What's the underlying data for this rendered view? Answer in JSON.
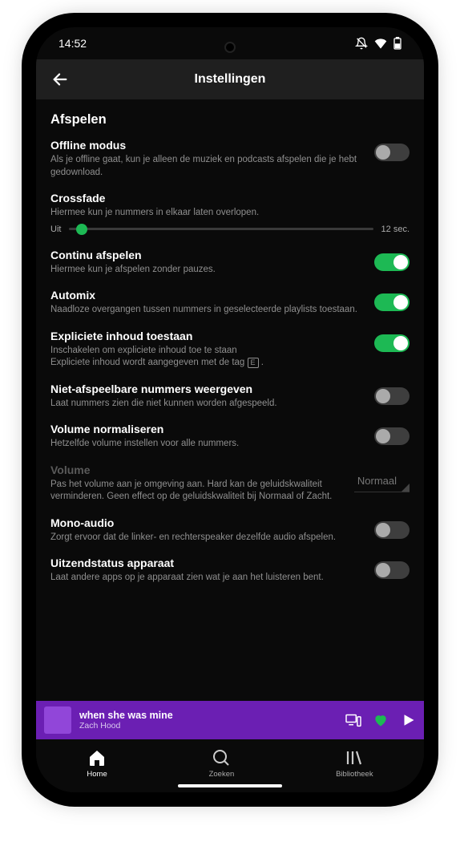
{
  "status": {
    "time": "14:52"
  },
  "header": {
    "title": "Instellingen"
  },
  "section": {
    "title": "Afspelen"
  },
  "settings": {
    "offline": {
      "title": "Offline modus",
      "desc": "Als je offline gaat, kun je alleen de muziek en podcasts afspelen die je hebt gedownload."
    },
    "crossfade": {
      "title": "Crossfade",
      "desc": "Hiermee kun je nummers in elkaar laten overlopen.",
      "min": "Uit",
      "max": "12 sec."
    },
    "continuous": {
      "title": "Continu afspelen",
      "desc": "Hiermee kun je afspelen zonder pauzes."
    },
    "automix": {
      "title": "Automix",
      "desc": "Naadloze overgangen tussen nummers in geselecteerde playlists toestaan."
    },
    "explicit": {
      "title": "Expliciete inhoud toestaan",
      "desc1": "Inschakelen om expliciete inhoud toe te staan",
      "desc2a": "Expliciete inhoud wordt aangegeven met de tag ",
      "tag": "E",
      "desc2b": " ."
    },
    "unplayable": {
      "title": "Niet-afspeelbare nummers weergeven",
      "desc": "Laat nummers zien die niet kunnen worden afgespeeld."
    },
    "normalize": {
      "title": "Volume normaliseren",
      "desc": "Hetzelfde volume instellen voor alle nummers."
    },
    "volume": {
      "title": "Volume",
      "desc": "Pas het volume aan je omgeving aan. Hard kan de geluidskwaliteit verminderen. Geen effect op de geluidskwaliteit bij Normaal of Zacht.",
      "value": "Normaal"
    },
    "mono": {
      "title": "Mono-audio",
      "desc": "Zorgt ervoor dat de linker- en rechterspeaker dezelfde audio afspelen."
    },
    "broadcast": {
      "title": "Uitzendstatus apparaat",
      "desc": "Laat andere apps op je apparaat zien wat je aan het luisteren bent."
    }
  },
  "nowplaying": {
    "title": "when she was mine",
    "artist": "Zach Hood"
  },
  "nav": {
    "home": "Home",
    "search": "Zoeken",
    "library": "Bibliotheek"
  }
}
